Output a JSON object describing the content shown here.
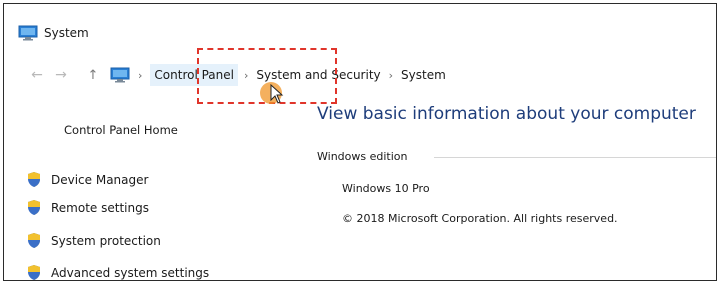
{
  "window": {
    "title": "System",
    "icon": "computer-monitor-icon"
  },
  "address_bar": {
    "back_icon": "back-arrow-icon",
    "forward_icon": "forward-arrow-icon",
    "up_icon": "up-arrow-icon",
    "location_icon": "computer-monitor-icon",
    "breadcrumbs": [
      "Control Panel",
      "System and Security",
      "System"
    ],
    "separator": "›",
    "hovered_crumb": "Control Panel"
  },
  "left_pane": {
    "home_link": "Control Panel Home",
    "tasks": [
      {
        "label": "Device Manager",
        "icon": "uac-shield-icon"
      },
      {
        "label": "Remote settings",
        "icon": "uac-shield-icon"
      },
      {
        "label": "System protection",
        "icon": "uac-shield-icon"
      },
      {
        "label": "Advanced system settings",
        "icon": "uac-shield-icon"
      }
    ]
  },
  "main": {
    "heading": "View basic information about your computer",
    "section_windows_edition": "Windows edition",
    "edition": "Windows 10 Pro",
    "copyright": "© 2018 Microsoft Corporation. All rights reserved."
  },
  "colors": {
    "heading": "#1e3d7b",
    "highlight_box": "#e0352b",
    "cursor_click": "#f09628",
    "crumb_hover_bg": "#e5f1fb"
  }
}
